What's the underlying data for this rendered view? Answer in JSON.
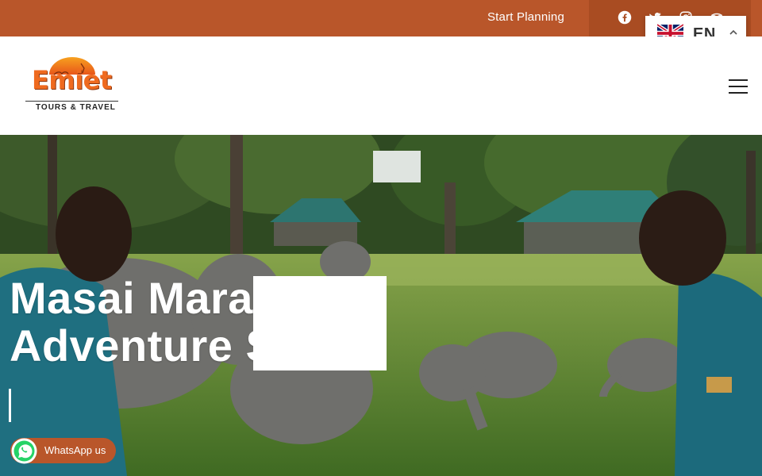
{
  "topbar": {
    "cta_label": "Start Planning",
    "social": [
      "facebook-icon",
      "twitter-icon",
      "instagram-icon",
      "tripadvisor-icon"
    ]
  },
  "language": {
    "code": "EN",
    "flag": "uk-flag-icon"
  },
  "brand": {
    "name": "Emiet",
    "tagline": "TOURS & TRAVEL",
    "colors": {
      "primary": "#b9562a",
      "logo_orange": "#ef6a1f"
    }
  },
  "hero": {
    "title_line1": "Masai Mara",
    "title_line2": "Adventure S"
  },
  "whatsapp": {
    "label": "WhatsApp us"
  }
}
